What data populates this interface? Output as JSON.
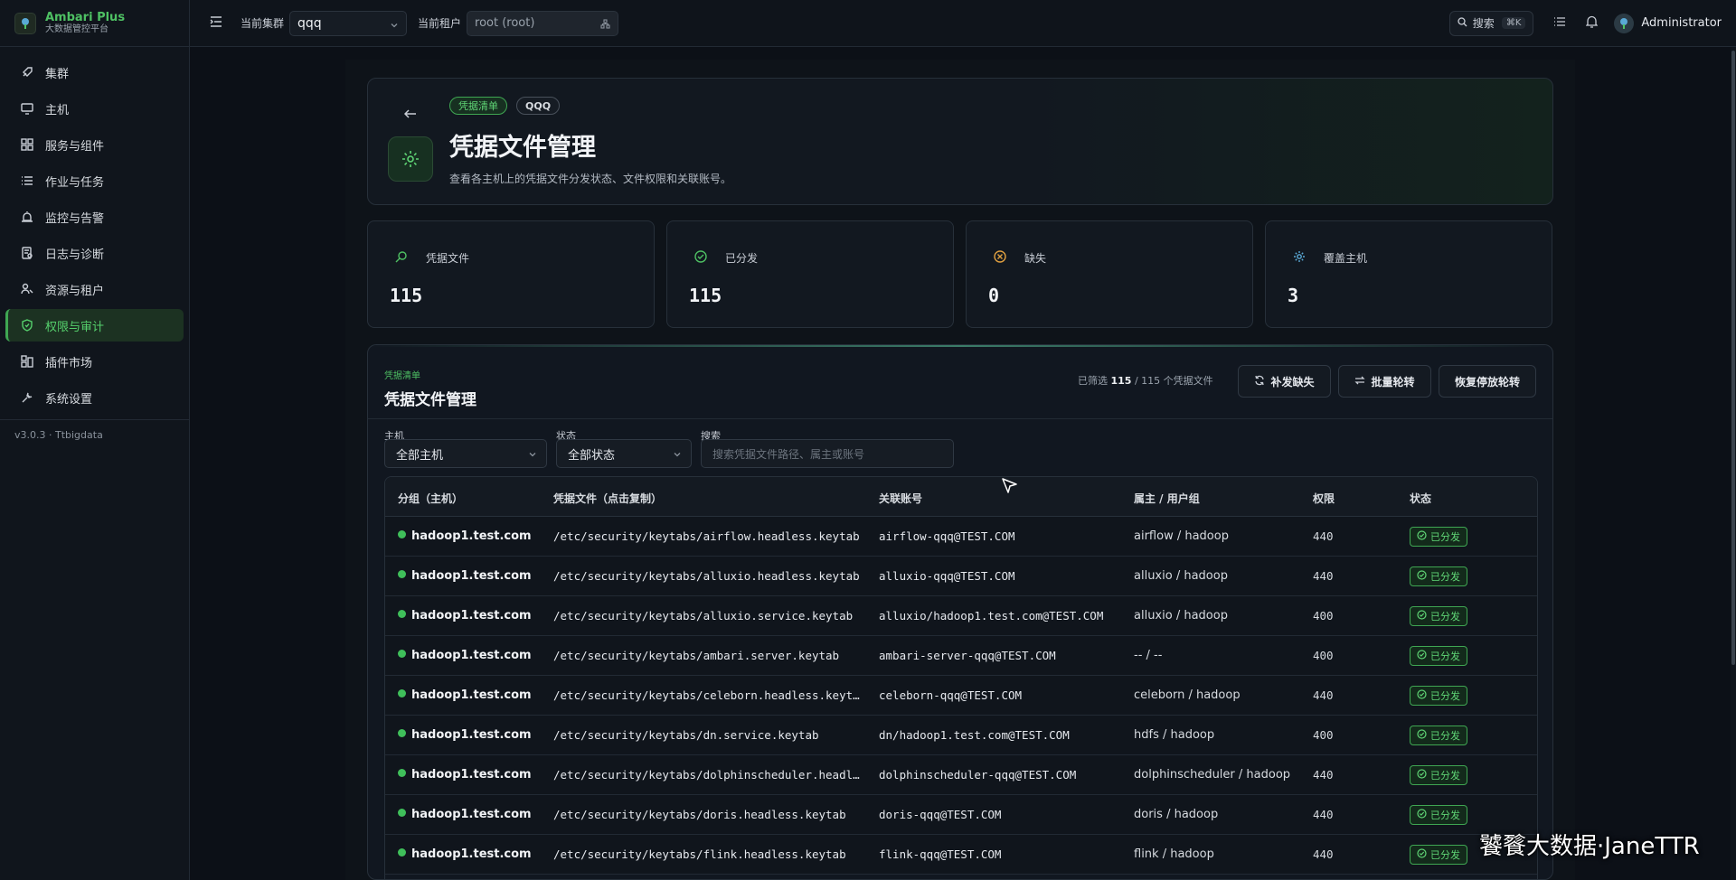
{
  "brand": {
    "name": "Ambari Plus",
    "subtitle": "大数据管控平台"
  },
  "sidebar": {
    "items": [
      {
        "label": "集群",
        "icon": "rocket-icon"
      },
      {
        "label": "主机",
        "icon": "monitor-icon"
      },
      {
        "label": "服务与组件",
        "icon": "grid-icon"
      },
      {
        "label": "作业与任务",
        "icon": "list-icon"
      },
      {
        "label": "监控与告警",
        "icon": "alarm-icon"
      },
      {
        "label": "日志与诊断",
        "icon": "log-icon"
      },
      {
        "label": "资源与租户",
        "icon": "users-icon"
      },
      {
        "label": "权限与审计",
        "icon": "shield-icon",
        "active": true
      },
      {
        "label": "插件市场",
        "icon": "plugin-icon"
      },
      {
        "label": "系统设置",
        "icon": "wrench-icon"
      }
    ],
    "version": "v3.0.3 · Ttbigdata"
  },
  "header": {
    "cluster_label": "当前集群",
    "cluster_value": "qqq",
    "tenant_label": "当前租户",
    "tenant_value": "root (root)",
    "search_label": "搜索",
    "search_kbd": "⌘K",
    "user": "Administrator"
  },
  "hero": {
    "tag1": "凭据清单",
    "tag2": "QQQ",
    "title": "凭据文件管理",
    "desc": "查看各主机上的凭据文件分发状态、文件权限和关联账号。"
  },
  "stats": [
    {
      "label": "凭据文件",
      "value": "115",
      "icon": "search-icon",
      "color": "#4ec063"
    },
    {
      "label": "已分发",
      "value": "115",
      "icon": "check-circle-icon",
      "color": "#4ec063"
    },
    {
      "label": "缺失",
      "value": "0",
      "icon": "x-circle-icon",
      "color": "#e0a040"
    },
    {
      "label": "覆盖主机",
      "value": "3",
      "icon": "gear-icon",
      "color": "#5aa9d6"
    }
  ],
  "panel": {
    "kicker": "凭据清单",
    "title": "凭据文件管理",
    "count_prefix": "已筛选",
    "count_value": "115",
    "count_suffix": "/ 115 个凭据文件",
    "btn_fill": "补发缺失",
    "btn_rotate": "批量轮转",
    "btn_resume": "恢复停放轮转",
    "filter_host_label": "主机",
    "filter_host_value": "全部主机",
    "filter_status_label": "状态",
    "filter_status_value": "全部状态",
    "filter_search_label": "搜索",
    "filter_search_placeholder": "搜索凭据文件路径、属主或账号"
  },
  "table": {
    "columns": [
      "分组（主机）",
      "凭据文件（点击复制）",
      "关联账号",
      "属主 / 用户组",
      "权限",
      "状态"
    ],
    "rows": [
      {
        "host": "hadoop1.test.com",
        "file": "/etc/security/keytabs/airflow.headless.keytab",
        "account": "airflow-qqq@TEST.COM",
        "owner": "airflow / hadoop",
        "perm": "440",
        "status": "已分发"
      },
      {
        "host": "hadoop1.test.com",
        "file": "/etc/security/keytabs/alluxio.headless.keytab",
        "account": "alluxio-qqq@TEST.COM",
        "owner": "alluxio / hadoop",
        "perm": "440",
        "status": "已分发"
      },
      {
        "host": "hadoop1.test.com",
        "file": "/etc/security/keytabs/alluxio.service.keytab",
        "account": "alluxio/hadoop1.test.com@TEST.COM",
        "owner": "alluxio / hadoop",
        "perm": "400",
        "status": "已分发"
      },
      {
        "host": "hadoop1.test.com",
        "file": "/etc/security/keytabs/ambari.server.keytab",
        "account": "ambari-server-qqq@TEST.COM",
        "owner": "-- / --",
        "perm": "400",
        "status": "已分发"
      },
      {
        "host": "hadoop1.test.com",
        "file": "/etc/security/keytabs/celeborn.headless.keytab",
        "account": "celeborn-qqq@TEST.COM",
        "owner": "celeborn / hadoop",
        "perm": "440",
        "status": "已分发"
      },
      {
        "host": "hadoop1.test.com",
        "file": "/etc/security/keytabs/dn.service.keytab",
        "account": "dn/hadoop1.test.com@TEST.COM",
        "owner": "hdfs / hadoop",
        "perm": "400",
        "status": "已分发"
      },
      {
        "host": "hadoop1.test.com",
        "file": "/etc/security/keytabs/dolphinscheduler.headless.keytab",
        "account": "dolphinscheduler-qqq@TEST.COM",
        "owner": "dolphinscheduler / hadoop",
        "perm": "440",
        "status": "已分发"
      },
      {
        "host": "hadoop1.test.com",
        "file": "/etc/security/keytabs/doris.headless.keytab",
        "account": "doris-qqq@TEST.COM",
        "owner": "doris / hadoop",
        "perm": "440",
        "status": "已分发"
      },
      {
        "host": "hadoop1.test.com",
        "file": "/etc/security/keytabs/flink.headless.keytab",
        "account": "flink-qqq@TEST.COM",
        "owner": "flink / hadoop",
        "perm": "440",
        "status": "已分发"
      }
    ]
  },
  "watermark": "饕餮大数据·JaneTTR"
}
